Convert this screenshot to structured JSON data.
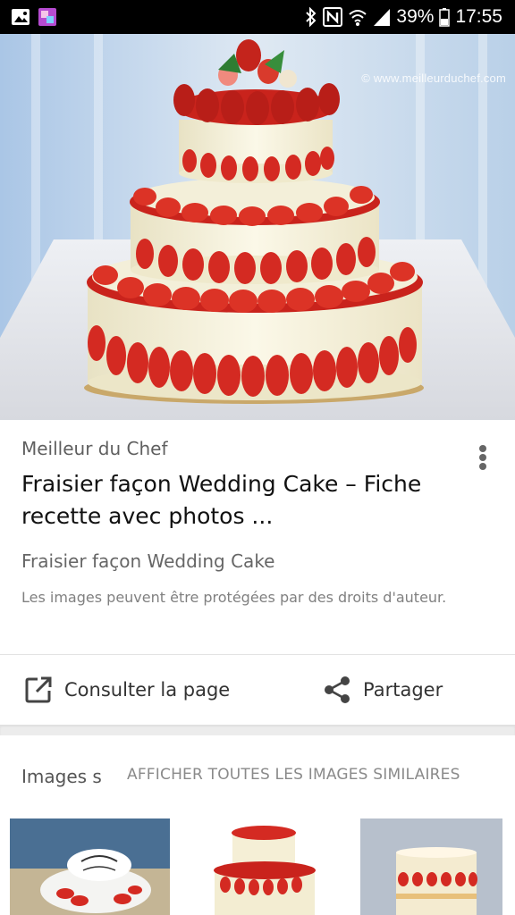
{
  "status_bar": {
    "battery": "39%",
    "time": "17:55",
    "icons": [
      "image-icon",
      "app-icon",
      "bluetooth-icon",
      "nfc-icon",
      "wifi-icon",
      "signal-icon",
      "battery-icon"
    ]
  },
  "hero": {
    "watermark": "© www.meilleurduchef.com"
  },
  "result": {
    "source": "Meilleur du Chef",
    "title": "Fraisier façon Wedding Cake – Fiche recette avec photos ...",
    "subtitle": "Fraisier façon Wedding Cake",
    "copyright": "Les images peuvent être protégées par des droits d'auteur."
  },
  "actions": {
    "consult_label": "Consulter la page",
    "share_label": "Partager"
  },
  "similar": {
    "label": "Images s",
    "show_all": "AFFICHER TOUTES LES IMAGES SIMILAIRES"
  },
  "colors": {
    "strawberry": "#d42a22",
    "cream": "#f6f2dc",
    "background": "#c7d8ea"
  }
}
